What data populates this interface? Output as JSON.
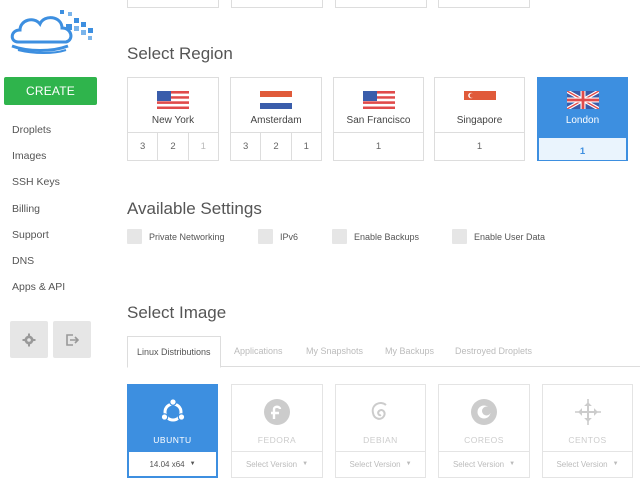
{
  "sidebar": {
    "create_label": "CREATE",
    "nav": [
      "Droplets",
      "Images",
      "SSH Keys",
      "Billing",
      "Support",
      "DNS",
      "Apps & API"
    ],
    "settings_icon": "gear-icon",
    "logout_icon": "logout-icon"
  },
  "region_section": {
    "title": "Select Region",
    "regions": [
      {
        "name": "New York",
        "flag": "us-flag",
        "nums": [
          "3",
          "2",
          "1"
        ]
      },
      {
        "name": "Amsterdam",
        "flag": "nl-flag",
        "nums": [
          "3",
          "2",
          "1"
        ]
      },
      {
        "name": "San Francisco",
        "flag": "us-flag",
        "nums": [
          "1"
        ]
      },
      {
        "name": "Singapore",
        "flag": "sg-flag",
        "nums": [
          "1"
        ]
      },
      {
        "name": "London",
        "flag": "uk-flag",
        "nums": [
          "1"
        ],
        "selected": true
      }
    ]
  },
  "settings_section": {
    "title": "Available Settings",
    "options": [
      "Private Networking",
      "IPv6",
      "Enable Backups",
      "Enable User Data"
    ]
  },
  "image_section": {
    "title": "Select Image",
    "tabs": [
      "Linux Distributions",
      "Applications",
      "My Snapshots",
      "My Backups",
      "Destroyed Droplets"
    ],
    "images": [
      {
        "name": "UBUNTU",
        "version": "14.04 x64",
        "icon": "ubuntu-icon",
        "selected": true
      },
      {
        "name": "FEDORA",
        "version": "Select Version",
        "icon": "fedora-icon"
      },
      {
        "name": "DEBIAN",
        "version": "Select Version",
        "icon": "debian-icon"
      },
      {
        "name": "COREOS",
        "version": "Select Version",
        "icon": "coreos-icon"
      },
      {
        "name": "CENTOS",
        "version": "Select Version",
        "icon": "centos-icon"
      }
    ]
  },
  "colors": {
    "accent": "#3d8fe0",
    "create": "#2fb44c"
  }
}
